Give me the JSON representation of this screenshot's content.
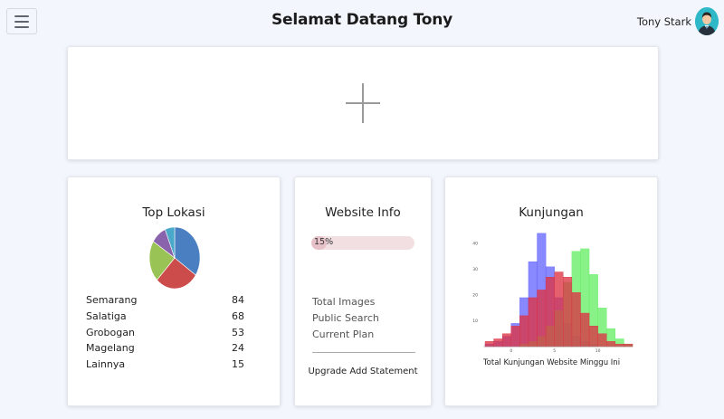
{
  "header": {
    "title": "Selamat Datang Tony",
    "user_name": "Tony Stark"
  },
  "top_lokasi": {
    "title": "Top Lokasi",
    "items": [
      {
        "name": "Semarang",
        "count": "84"
      },
      {
        "name": "Salatiga",
        "count": "68"
      },
      {
        "name": "Grobogan",
        "count": "53"
      },
      {
        "name": "Magelang",
        "count": "24"
      },
      {
        "name": "Lainnya",
        "count": "15"
      }
    ]
  },
  "website_info": {
    "title": "Website Info",
    "progress_label": "15%",
    "progress_value": 15,
    "items": [
      "Total Images",
      "Public Search",
      "Current Plan"
    ],
    "upgrade_label": "Upgrade Add Statement"
  },
  "kunjungan": {
    "title": "Kunjungan",
    "chart_label": "Total Kunjungan Website Minggu Ini"
  },
  "chart_data": [
    {
      "type": "pie",
      "categories": [
        "Semarang",
        "Salatiga",
        "Grobogan",
        "Magelang",
        "Lainnya"
      ],
      "values": [
        84,
        68,
        53,
        24,
        15
      ],
      "colors": [
        "#4a7fc1",
        "#cc4b4b",
        "#9ac356",
        "#8a63ad",
        "#4aa9c9"
      ]
    },
    {
      "type": "bar",
      "xlabel": "Total Kunjungan Website Minggu Ini",
      "x_ticks": [
        "0",
        "5",
        "10"
      ],
      "y_ticks": [
        "10",
        "20",
        "30",
        "40"
      ],
      "ylim": [
        0,
        45
      ],
      "bins": [
        -3,
        -2,
        -1,
        0,
        1,
        2,
        3,
        4,
        5,
        6,
        7,
        8,
        9,
        10,
        11,
        12,
        13,
        14
      ],
      "series": [
        {
          "color": "#6666ff",
          "values": [
            1,
            2,
            4,
            9,
            19,
            33,
            44,
            31,
            19,
            9,
            4,
            2,
            1,
            0,
            0,
            0,
            0
          ]
        },
        {
          "color": "#66ee66",
          "values": [
            0,
            0,
            0,
            0,
            1,
            2,
            4,
            8,
            14,
            25,
            37,
            38,
            28,
            15,
            7,
            3,
            1
          ]
        },
        {
          "color": "#dd3344",
          "values": [
            2,
            3,
            5,
            8,
            12,
            19,
            22,
            27,
            29,
            27,
            21,
            13,
            8,
            5,
            2,
            1,
            1
          ]
        }
      ]
    }
  ]
}
